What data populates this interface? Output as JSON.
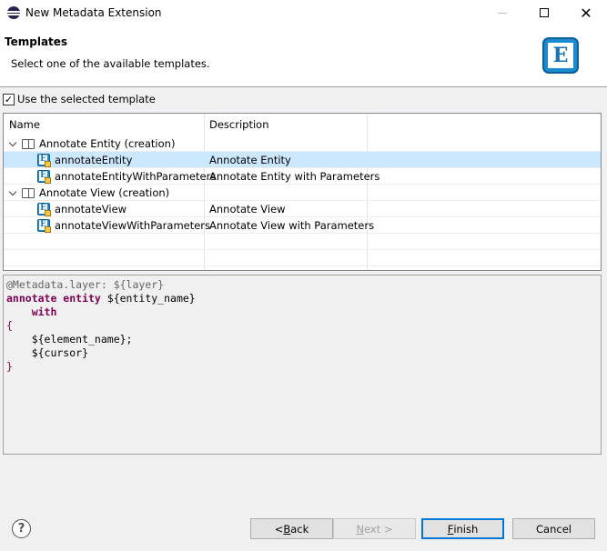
{
  "window": {
    "title": "New Metadata Extension",
    "icon": "eclipse-icon",
    "controls": [
      "minimize",
      "maximize",
      "close"
    ],
    "close_glyph": "✕"
  },
  "banner": {
    "title": "Templates",
    "description": "Select one of the available templates.",
    "logo_letter": "E"
  },
  "use_template": {
    "label": "Use the selected template",
    "checked": true,
    "check_glyph": "✓"
  },
  "table": {
    "columns": [
      "Name",
      "Description"
    ],
    "rows": [
      {
        "type": "group",
        "name": "Annotate Entity (creation)",
        "description": "",
        "expanded": true
      },
      {
        "type": "template",
        "name": "annotateEntity",
        "description": "Annotate Entity",
        "selected": true
      },
      {
        "type": "template",
        "name": "annotateEntityWithParameters",
        "description": "Annotate Entity with Parameters",
        "selected": false
      },
      {
        "type": "group",
        "name": "Annotate View (creation)",
        "description": "",
        "expanded": true
      },
      {
        "type": "template",
        "name": "annotateView",
        "description": "Annotate View",
        "selected": false
      },
      {
        "type": "template",
        "name": "annotateViewWithParameters",
        "description": "Annotate View with Parameters",
        "selected": false
      }
    ]
  },
  "preview": {
    "lines": [
      [
        {
          "t": "@Metadata.layer: ${layer}",
          "c": "annot"
        }
      ],
      [
        {
          "t": "annotate entity ",
          "c": "kw"
        },
        {
          "t": "${entity_name}",
          "c": "var"
        }
      ],
      [
        {
          "t": "    with",
          "c": "kw"
        }
      ],
      [
        {
          "t": "{",
          "c": "brace"
        }
      ],
      [
        {
          "t": "    ${element_name};",
          "c": "var"
        }
      ],
      [
        {
          "t": "    ${cursor}",
          "c": "var"
        }
      ],
      [
        {
          "t": "}",
          "c": "brace"
        }
      ]
    ]
  },
  "footer": {
    "help_glyph": "?",
    "back": {
      "prefix": "< ",
      "mnemonic": "B",
      "rest": "ack"
    },
    "next": {
      "prefix": "",
      "mnemonic": "N",
      "rest": "ext >",
      "enabled": false
    },
    "finish": {
      "prefix": "",
      "mnemonic": "F",
      "rest": "inish",
      "default": true
    },
    "cancel": {
      "label": "Cancel"
    }
  }
}
